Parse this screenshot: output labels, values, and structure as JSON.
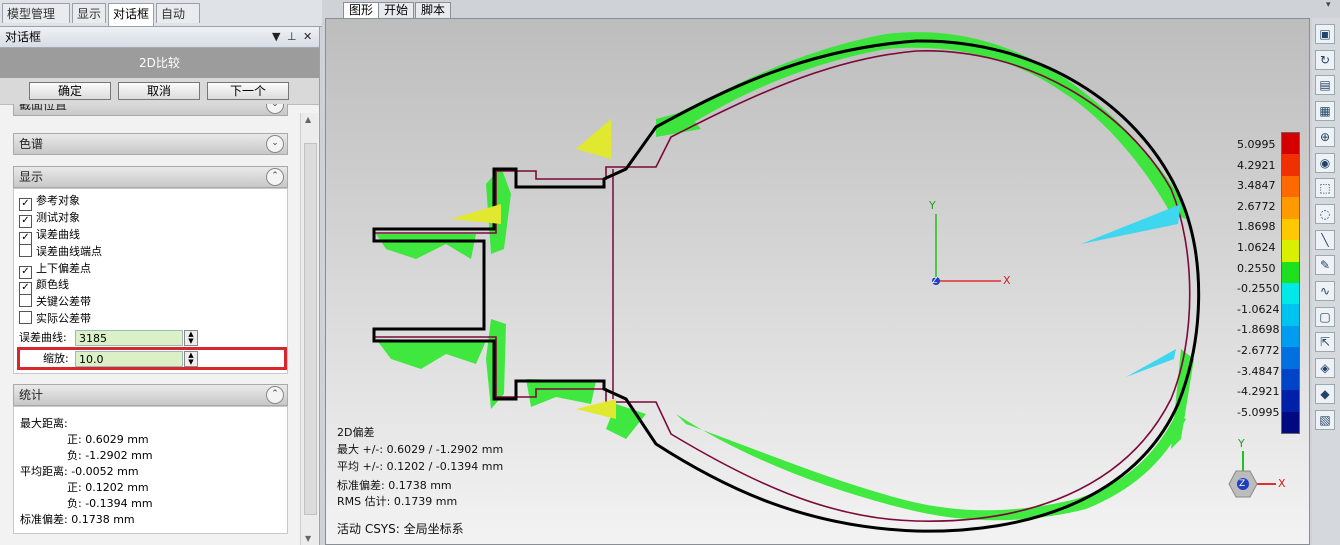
{
  "left_tabs": [
    "模型管理器",
    "显示",
    "对话框",
    "自动化"
  ],
  "panel": {
    "title": "对话框",
    "title_controls": [
      "▼",
      "⊥",
      "✕"
    ],
    "dialog_title": "2D比较",
    "buttons": {
      "ok": "确定",
      "cancel": "取消",
      "next": "下一个"
    },
    "sections": {
      "partial": "截面位置",
      "spectrum": "色谱",
      "display": "显示",
      "stats": "统计"
    },
    "display_options": [
      {
        "label": "参考对象",
        "checked": true
      },
      {
        "label": "测试对象",
        "checked": true
      },
      {
        "label": "误差曲线",
        "checked": true
      },
      {
        "label": "误差曲线端点",
        "checked": false
      },
      {
        "label": "上下偏差点",
        "checked": true
      },
      {
        "label": "颜色线",
        "checked": true
      },
      {
        "label": "关键公差带",
        "checked": false
      },
      {
        "label": "实际公差带",
        "checked": false
      }
    ],
    "error_curve_label": "误差曲线:",
    "error_curve_value": "3185",
    "scale_label": "缩放:",
    "scale_value": "10.0",
    "stats": {
      "max_label": "最大距离:",
      "max_pos": "正: 0.6029 mm",
      "max_neg": "负: -1.2902 mm",
      "avg_label": "平均距离: -0.0052 mm",
      "avg_pos": "正: 0.1202 mm",
      "avg_neg": "负: -0.1394 mm",
      "std": "标准偏差: 0.1738 mm"
    }
  },
  "view_tabs": [
    "图形",
    "开始",
    "脚本"
  ],
  "viewport": {
    "info": {
      "title": "2D偏差",
      "max": "最大 +/-: 0.6029 / -1.2902 mm",
      "avg": "平均 +/-: 0.1202 / -0.1394 mm",
      "std": "标准偏差: 0.1738 mm",
      "rms": "RMS 估计: 0.1739 mm"
    },
    "csys": "活动 CSYS: 全局坐标系",
    "axis_labels": {
      "x": "X",
      "y": "Y",
      "z": "Z"
    },
    "legend": {
      "labels": [
        "5.0995",
        "4.2921",
        "3.4847",
        "2.6772",
        "1.8698",
        "1.0624",
        "0.2550",
        "-0.2550",
        "-1.0624",
        "-1.8698",
        "-2.6772",
        "-3.4847",
        "-4.2921",
        "-5.0995"
      ],
      "colors": [
        "#d40000",
        "#f03000",
        "#ff6a00",
        "#ff9a00",
        "#ffc800",
        "#d8f000",
        "#1ee01e",
        "#00e8e8",
        "#00c4f0",
        "#009cf0",
        "#0070e0",
        "#0044c8",
        "#0020a8",
        "#000a80"
      ]
    }
  },
  "toolbar_icons": [
    "view-cube-icon",
    "rotate-icon",
    "front-view-icon",
    "layers-icon",
    "zoom-icon",
    "color-map-icon",
    "select-rect-icon",
    "select-lasso-icon",
    "line-tool-icon",
    "brush-icon",
    "curve-icon",
    "polygon-select-icon",
    "arrow-select-icon",
    "tool-a-icon",
    "tool-b-icon",
    "tool-c-icon"
  ]
}
